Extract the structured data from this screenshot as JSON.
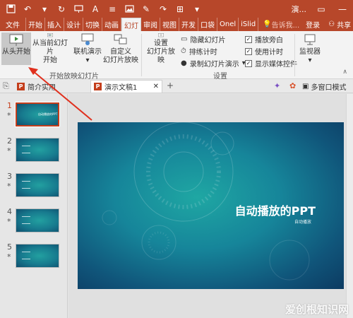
{
  "titlebar": {
    "doc_title": "演...",
    "colors": {
      "accent": "#b7472a",
      "ribbon_bg": "#f3f3f3"
    }
  },
  "tabs": [
    {
      "label": "文件"
    },
    {
      "label": "开始"
    },
    {
      "label": "插入"
    },
    {
      "label": "设计"
    },
    {
      "label": "切换"
    },
    {
      "label": "动画"
    },
    {
      "label": "幻灯",
      "active": true
    },
    {
      "label": "审阅"
    },
    {
      "label": "视图"
    },
    {
      "label": "开发"
    },
    {
      "label": "口袋"
    },
    {
      "label": "Onel"
    },
    {
      "label": "iSlid"
    }
  ],
  "search_hint": "告诉我...",
  "login_label": "登录",
  "share_label": "共享",
  "ribbon": {
    "from_beginning": "从头开始",
    "from_current_line1": "从当前幻灯片",
    "from_current_line2": "开始",
    "online_present": "联机演示",
    "custom_show_line1": "自定义",
    "custom_show_line2": "幻灯片放映",
    "start_group_label": "开始放映幻灯片",
    "setup_show_line1": "设置",
    "setup_show_line2": "幻灯片放映",
    "hide_slide": "隐藏幻灯片",
    "rehearse": "排练计时",
    "record": "录制幻灯片演示",
    "play_narrations": "播放旁白",
    "use_timings": "使用计时",
    "show_media": "显示媒体控件",
    "setup_group_label": "设置",
    "monitors": "监视器"
  },
  "doc_tabs": {
    "tab1": "简介实用",
    "tab2": "演示文稿1",
    "multi_window": "多窗口模式"
  },
  "thumbnails": [
    {
      "num": "1",
      "star": "*",
      "title": "自动播放的PPT"
    },
    {
      "num": "2",
      "star": "*"
    },
    {
      "num": "3",
      "star": "*"
    },
    {
      "num": "4",
      "star": "*"
    },
    {
      "num": "5",
      "star": "*"
    }
  ],
  "slide": {
    "title": "自动播放的PPT",
    "subtitle": "自动播放"
  },
  "watermark": "爱创根知识网"
}
